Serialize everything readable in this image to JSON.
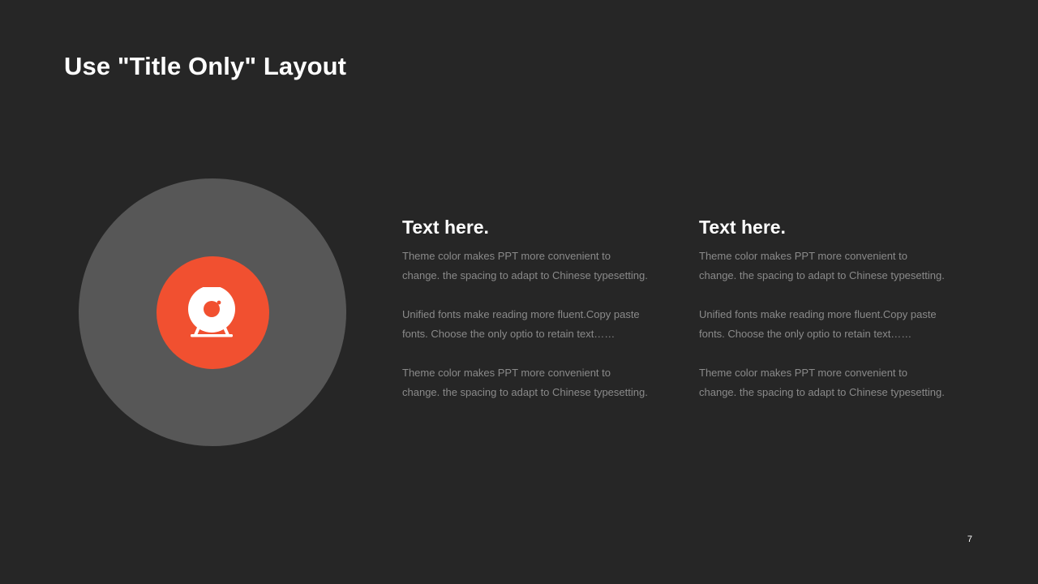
{
  "slide": {
    "title": "Use \"Title Only\" Layout",
    "page_number": "7",
    "icon": {
      "name": "webcam-icon",
      "accent_color": "#f15030",
      "outer_ring_color": "#575757"
    }
  },
  "columns": [
    {
      "heading": "Text here.",
      "paragraphs": [
        "Theme  color makes PPT more convenient  to\nchange. the spacing to adapt to Chinese  typesetting.",
        "Unified  fonts make reading more fluent.Copy paste\nfonts. Choose the only optio to retain text……",
        "Theme  color makes PPT more convenient  to\nchange. the spacing to adapt to Chinese  typesetting."
      ]
    },
    {
      "heading": "Text here.",
      "paragraphs": [
        "Theme  color makes PPT more convenient  to\nchange. the spacing to adapt to Chinese  typesetting.",
        "Unified  fonts make reading more fluent.Copy paste\nfonts. Choose the only optio to retain text……",
        "Theme  color makes PPT more convenient  to\nchange. the spacing to adapt to Chinese  typesetting."
      ]
    }
  ]
}
